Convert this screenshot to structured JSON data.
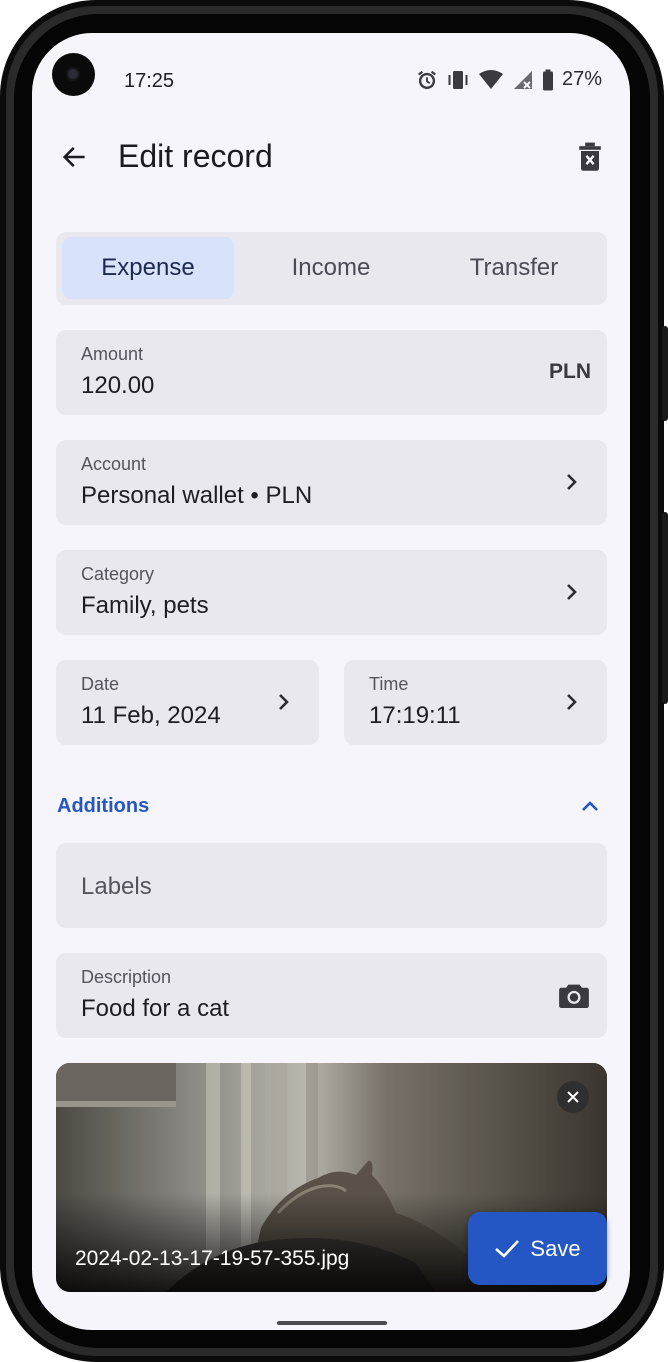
{
  "status_bar": {
    "time": "17:25",
    "battery_percent": "27%",
    "icons": [
      "alarm-icon",
      "vibrate-icon",
      "wifi-icon",
      "signal-off-icon",
      "battery-icon"
    ]
  },
  "app_bar": {
    "title": "Edit record",
    "back_icon": "arrow-back-icon",
    "delete_icon": "delete-icon"
  },
  "record_type": {
    "tabs": [
      {
        "label": "Expense",
        "selected": true
      },
      {
        "label": "Income",
        "selected": false
      },
      {
        "label": "Transfer",
        "selected": false
      }
    ]
  },
  "amount": {
    "label": "Amount",
    "value": "120.00",
    "currency": "PLN"
  },
  "account": {
    "label": "Account",
    "value": "Personal wallet • PLN"
  },
  "category": {
    "label": "Category",
    "value": "Family, pets"
  },
  "date": {
    "label": "Date",
    "value": "11 Feb, 2024"
  },
  "time": {
    "label": "Time",
    "value": "17:19:11"
  },
  "additions": {
    "label": "Additions",
    "toggle_icon": "chevron-up-icon"
  },
  "labels": {
    "placeholder": "Labels"
  },
  "description": {
    "label": "Description",
    "value": "Food for a cat",
    "camera_icon": "camera-icon"
  },
  "attachment": {
    "file_name": "2024-02-13-17-19-57-355.jpg",
    "remove_icon": "close-icon"
  },
  "save_button": {
    "label": "Save",
    "icon": "check-icon"
  },
  "colors": {
    "accent": "#2557c4",
    "background": "#f6f5fb",
    "field_background": "#e9e8ef",
    "selected_tab": "#d9e2fb"
  }
}
